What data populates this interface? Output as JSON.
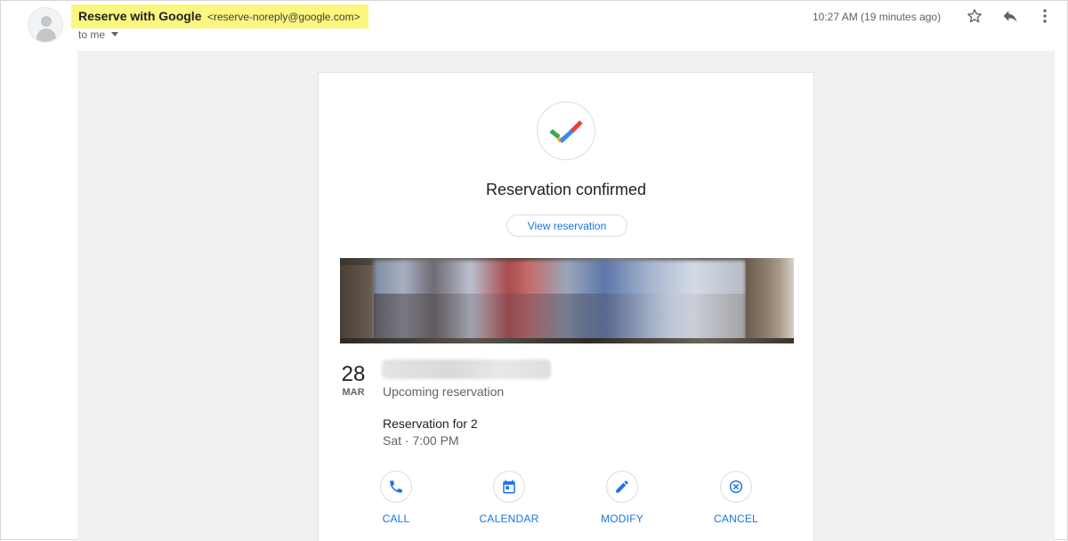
{
  "header": {
    "sender_name": "Reserve with Google",
    "sender_email": "<reserve-noreply@google.com>",
    "recipient": "to me",
    "timestamp": "10:27 AM (19 minutes ago)",
    "icons": [
      "avatar-icon",
      "star-icon",
      "reply-icon",
      "more-vert-icon"
    ]
  },
  "card": {
    "title": "Reservation confirmed",
    "view_button": "View reservation",
    "date_day": "28",
    "date_month": "MAR",
    "status": "Upcoming reservation",
    "party": "Reservation for 2",
    "time": "Sat · 7:00 PM"
  },
  "actions": [
    {
      "label": "CALL",
      "icon": "phone-icon"
    },
    {
      "label": "CALENDAR",
      "icon": "calendar-icon"
    },
    {
      "label": "MODIFY",
      "icon": "pencil-icon"
    },
    {
      "label": "CANCEL",
      "icon": "cancel-icon"
    }
  ],
  "colors": {
    "accent": "#1a73e8",
    "highlight": "#fbf77f",
    "mail_background": "#f1f1f1",
    "check_green": "#34a853",
    "check_yellow": "#fbbc04",
    "check_red": "#ea4335",
    "check_blue": "#4285f4"
  }
}
